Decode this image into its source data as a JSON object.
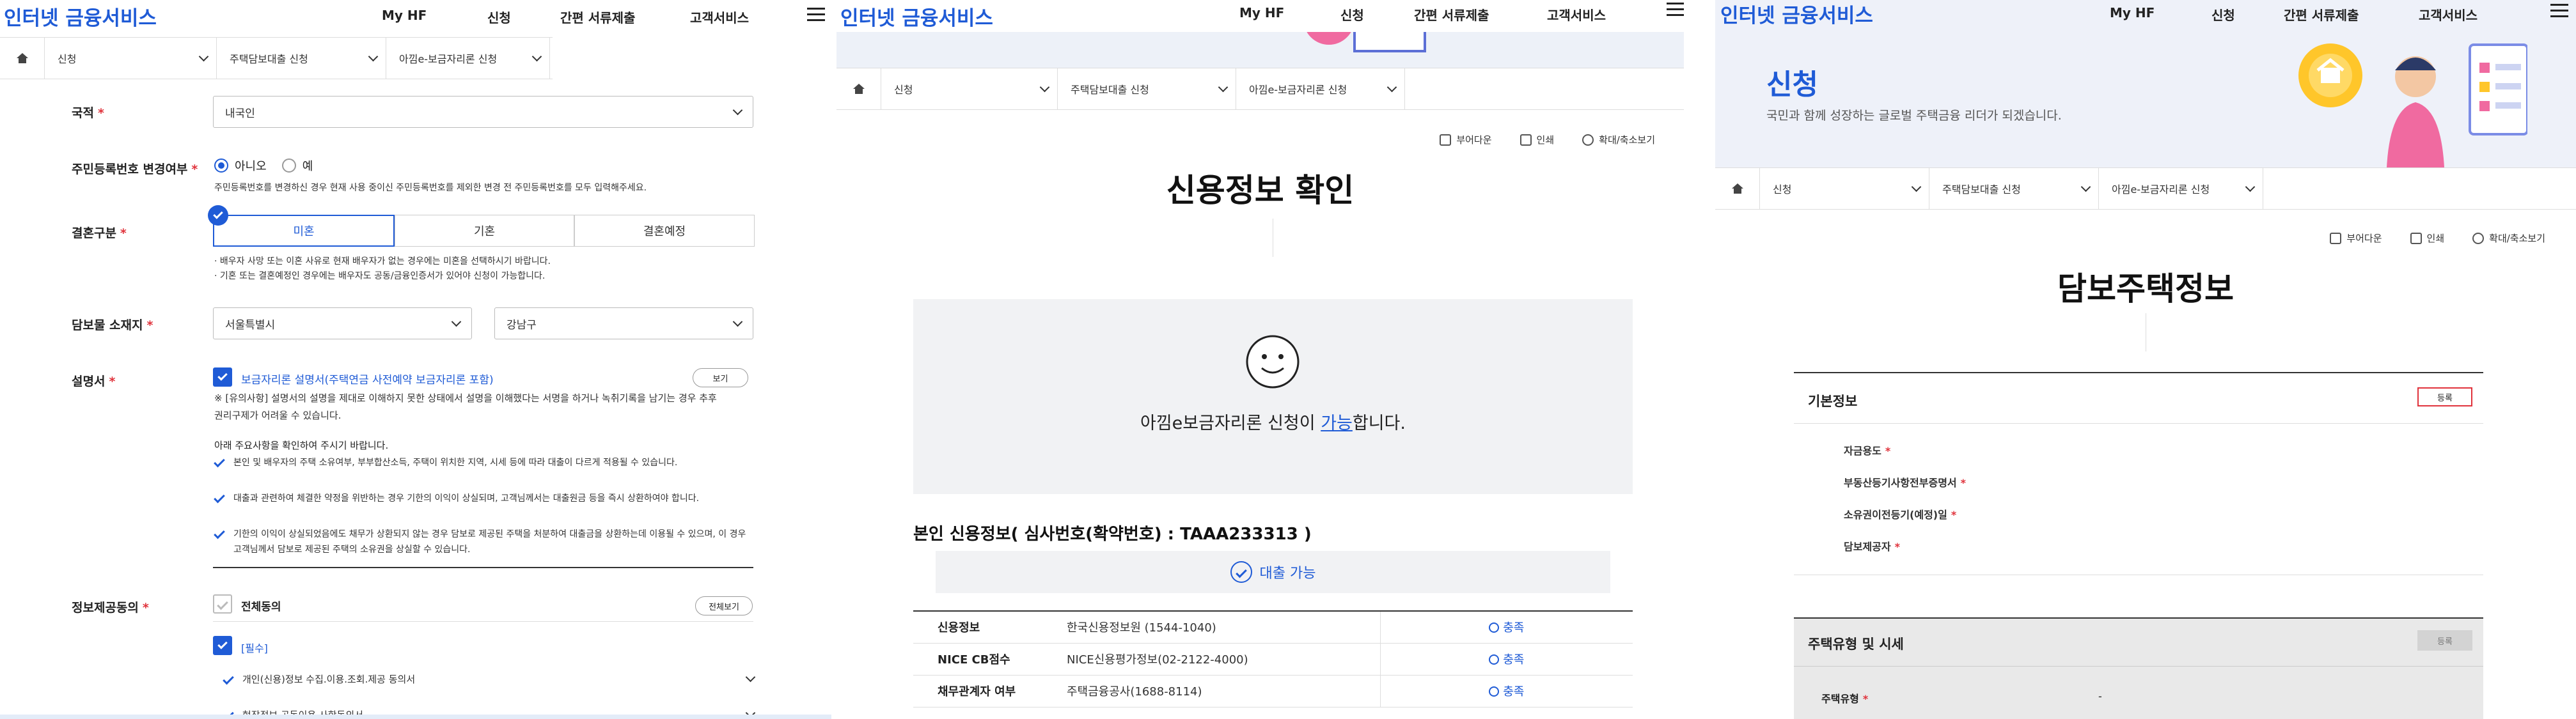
{
  "header": {
    "logo": "인터넷 금융서비스",
    "nav": [
      "My HF",
      "신청",
      "간편 서류제출",
      "고객서비스"
    ]
  },
  "breadcrumb": [
    "신청",
    "주택담보대출 신청",
    "아낌e-보금자리론 신청"
  ],
  "tools": {
    "download": "부어다운",
    "print": "인쇄",
    "zoom": "확대/축소보기"
  },
  "form": {
    "nationality": {
      "label": "국적",
      "value": "내국인"
    },
    "rrn_change": {
      "label": "주민등록번호 변경여부",
      "opt_no": "아니오",
      "opt_yes": "예",
      "note": "주민등록번호를 변경하신 경우 현재 사용 중이신 주민등록번호를 제외한 변경 전 주민등록번호를 모두 입력해주세요."
    },
    "marriage": {
      "label": "결혼구분",
      "options": [
        "미혼",
        "기혼",
        "결혼예정"
      ],
      "notes": [
        "· 배우자 사망 또는 이혼 사유로 현재 배우자가 없는 경우에는 미혼을 선택하시기 바랍니다.",
        "· 기혼 또는 결혼예정인 경우에는 배우자도 공동/금융인증서가 있어야 신청이 가능합니다."
      ]
    },
    "location": {
      "label": "담보물 소재지",
      "city": "서울특별시",
      "district": "강남구"
    },
    "manual": {
      "label": "설명서",
      "check_text": "보금자리론 설명서(주택연금 사전예약 보금자리론 포함)",
      "view_button": "보기",
      "warning": "※ [유의사항] 설명서의 설명을 제대로 이해하지 못한 상태에서 설명을 이해했다는 서명을 하거나 녹취기록을 남기는 경우 추후 권리구제가 어려울 수 있습니다.",
      "items_title": "아래 주요사항을 확인하여 주시기 바랍니다.",
      "items": [
        "본인 및 배우자의 주택 소유여부, 부부합산소득, 주택이 위치한 지역, 시세 등에 따라 대출이 다르게 적용될 수 있습니다.",
        "대출과 관련하여 체결한 약정을 위반하는 경우 기한의 이익이 상실되며, 고객님께서는 대출원금 등을 즉시 상환하여야 합니다.",
        "기한의 이익이 상실되었음에도 채무가 상환되지 않는 경우 담보로 제공된 주택을 처분하여 대출금을 상환하는데 이용될 수 있으며, 이 경우 고객님께서 담보로 제공된 주택의 소유권을 상실할 수 있습니다."
      ]
    },
    "consent": {
      "label": "정보제공동의",
      "all": "전체동의",
      "all_view": "전체보기",
      "required": "[필수]",
      "items": [
        "개인(신용)정보 수집.이용.조회.제공 동의서",
        "현장정보 공동이용 사항동의서"
      ]
    }
  },
  "credit": {
    "title": "신용정보 확인",
    "result_prefix": "아낌e보금자리론 신청이 ",
    "result_link": "가능",
    "result_suffix": "합니다.",
    "section_title": "본인 신용정보( 심사번호(확약번호) : TAAA233313 )",
    "status": "대출 가능",
    "rows": [
      {
        "name": "신용정보",
        "org": "한국신용정보원 (1544-1040)",
        "result": "충족"
      },
      {
        "name": "NICE CB점수",
        "org": "NICE신용평가정보(02-2122-4000)",
        "result": "충족"
      },
      {
        "name": "채무관계자 여부",
        "org": "주택금융공사(1688-8114)",
        "result": "충족"
      }
    ]
  },
  "collateral": {
    "banner_title": "신청",
    "banner_sub": "국민과 함께 성장하는 글로벌 주택금융 리더가 되겠습니다.",
    "title": "담보주택정보",
    "basic_title": "기본정보",
    "register": "등록",
    "fields": [
      "자금용도",
      "부동산등기사항전부증명서",
      "소유권이전등기(예정)일",
      "담보제공자"
    ],
    "price_title": "주택유형 및 시세",
    "price_register": "등록",
    "house_type_label": "주택유형",
    "house_type_value": "-"
  }
}
